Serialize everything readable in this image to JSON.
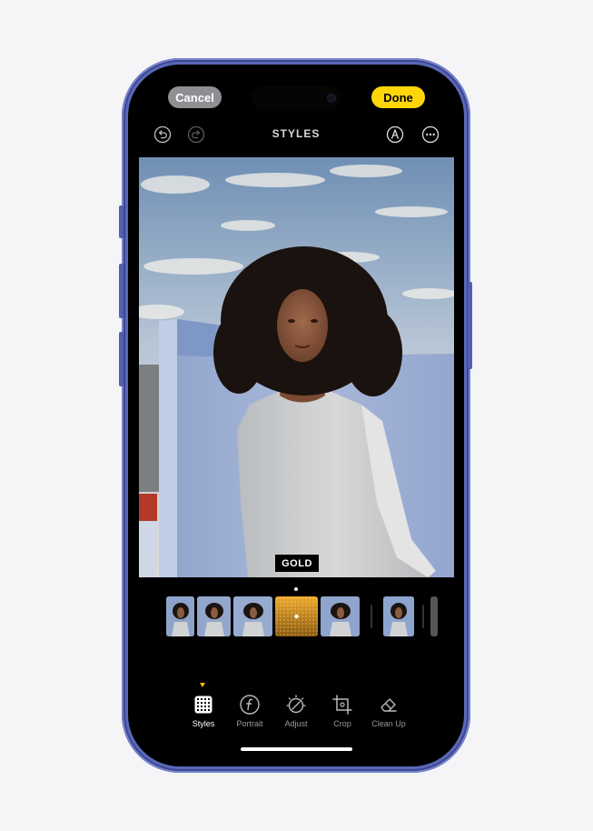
{
  "toolbar": {
    "cancel_label": "Cancel",
    "done_label": "Done",
    "title": "STYLES"
  },
  "icons": [
    "undo-icon",
    "redo-icon",
    "markup-pen-icon",
    "more-icon"
  ],
  "photo": {
    "style_label": "GOLD"
  },
  "style_strip": {
    "selected_index": 3
  },
  "tools": [
    {
      "label": "Styles",
      "icon": "styles-grid-icon",
      "active": true
    },
    {
      "label": "Portrait",
      "icon": "portrait-f-icon",
      "active": false
    },
    {
      "label": "Adjust",
      "icon": "adjust-dial-icon",
      "active": false
    },
    {
      "label": "Crop",
      "icon": "crop-icon",
      "active": false
    },
    {
      "label": "Clean Up",
      "icon": "eraser-icon",
      "active": false
    }
  ],
  "colors": {
    "done_bg": "#ffd60a",
    "cancel_bg": "#8e8e93",
    "active_caret": "#ffb400",
    "frame": "#5a68b8"
  }
}
